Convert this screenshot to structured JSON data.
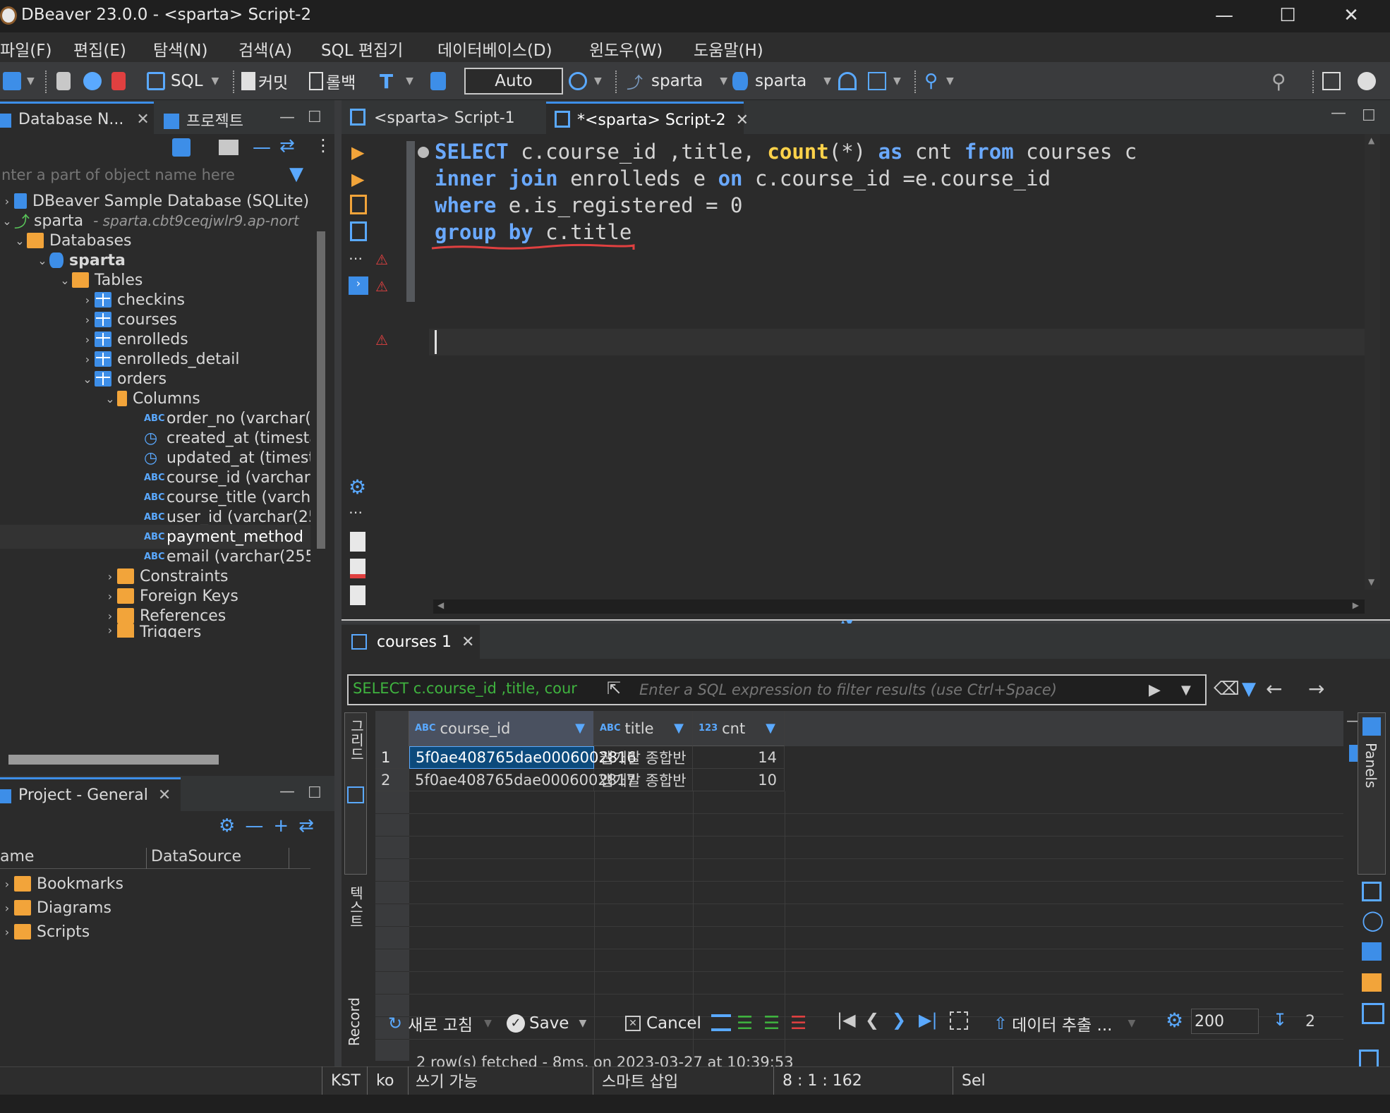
{
  "window": {
    "title": "DBeaver 23.0.0 - <sparta> Script-2"
  },
  "menu": [
    "파일(F)",
    "편집(E)",
    "탐색(N)",
    "검색(A)",
    "SQL 편집기",
    "데이터베이스(D)",
    "윈도우(W)",
    "도움말(H)"
  ],
  "toolbar": {
    "sql_label": "SQL",
    "commit_label": "커밋",
    "rollback_label": "롤백",
    "txn_mode": "Auto",
    "datasource": "sparta",
    "schema": "sparta"
  },
  "navigator": {
    "tab_label": "Database N...",
    "project_tab_label": "프로젝트",
    "filter_placeholder": "nter a part of object name here",
    "items": [
      {
        "label": "DBeaver Sample Database (SQLite)"
      },
      {
        "label": "sparta",
        "detail": "- sparta.cbt9ceqjwlr9.ap-nort"
      },
      {
        "label": "Databases"
      },
      {
        "label": "sparta"
      },
      {
        "label": "Tables"
      },
      {
        "label": "checkins"
      },
      {
        "label": "courses"
      },
      {
        "label": "enrolleds"
      },
      {
        "label": "enrolleds_detail"
      },
      {
        "label": "orders"
      },
      {
        "label": "Columns"
      },
      {
        "label": "order_no (varchar("
      },
      {
        "label": "created_at (timesta"
      },
      {
        "label": "updated_at (timest"
      },
      {
        "label": "course_id (varchar("
      },
      {
        "label": "course_title (varcha"
      },
      {
        "label": "user_id (varchar(25"
      },
      {
        "label": "payment_method"
      },
      {
        "label": "email (varchar(255"
      },
      {
        "label": "Constraints"
      },
      {
        "label": "Foreign Keys"
      },
      {
        "label": "References"
      },
      {
        "label": "Triggers"
      }
    ]
  },
  "project": {
    "tab_label": "Project - General",
    "columns": [
      "ame",
      "DataSource"
    ],
    "items": [
      "Bookmarks",
      "Diagrams",
      "Scripts"
    ]
  },
  "editor": {
    "tabs": [
      {
        "label": "<sparta> Script-1"
      },
      {
        "label": "*<sparta> Script-2"
      }
    ],
    "lines": [
      [
        {
          "t": "SELECT",
          "c": "kw"
        },
        {
          "t": " c.course_id ,title, ",
          "c": ""
        },
        {
          "t": "count",
          "c": "fn"
        },
        {
          "t": "(*) ",
          "c": ""
        },
        {
          "t": "as",
          "c": "kw"
        },
        {
          "t": " cnt ",
          "c": ""
        },
        {
          "t": "from",
          "c": "kw"
        },
        {
          "t": " courses c",
          "c": ""
        }
      ],
      [
        {
          "t": "inner join",
          "c": "kw"
        },
        {
          "t": " enrolleds e ",
          "c": ""
        },
        {
          "t": "on",
          "c": "kw"
        },
        {
          "t": " c.course_id =e.course_id",
          "c": ""
        }
      ],
      [
        {
          "t": "where",
          "c": "kw"
        },
        {
          "t": " e.is_registered = 0",
          "c": ""
        }
      ],
      [
        {
          "t": "group by",
          "c": "kw"
        },
        {
          "t": " c.title",
          "c": ""
        }
      ]
    ]
  },
  "results": {
    "tab_label": "courses 1",
    "query_preview": "SELECT c.course_id ,title, cour",
    "filter_placeholder": "Enter a SQL expression to filter results (use Ctrl+Space)",
    "side_tabs": [
      "그리드",
      "텍스트",
      "Record"
    ],
    "columns": [
      {
        "type": "ABC",
        "name": "course_id"
      },
      {
        "type": "ABC",
        "name": "title"
      },
      {
        "type": "123",
        "name": "cnt"
      }
    ],
    "rows": [
      {
        "num": "1",
        "course_id": "5f0ae408765dae0006002816",
        "title": "웹개발 종합반",
        "cnt": "14"
      },
      {
        "num": "2",
        "course_id": "5f0ae408765dae0006002817",
        "title": "앱개발 종합반",
        "cnt": "10"
      }
    ],
    "footer": {
      "refresh": "새로 고침",
      "save": "Save",
      "cancel": "Cancel",
      "export": "데이터 추출 ...",
      "fetch_size": "200",
      "count": "2"
    },
    "status": "2 row(s) fetched - 8ms, on 2023-03-27 at 10:39:53",
    "panels_label": "Panels"
  },
  "statusbar": {
    "tz": "KST",
    "locale": "ko",
    "mode": "쓰기 가능",
    "insert": "스마트 삽입",
    "pos": "8 : 1 : 162",
    "sel": "Sel"
  },
  "colors": {
    "accent": "#3d8ee8",
    "keyword": "#6aa9ff",
    "function": "#ffd24a",
    "error": "#e04040",
    "selection": "#0c4a7c"
  }
}
